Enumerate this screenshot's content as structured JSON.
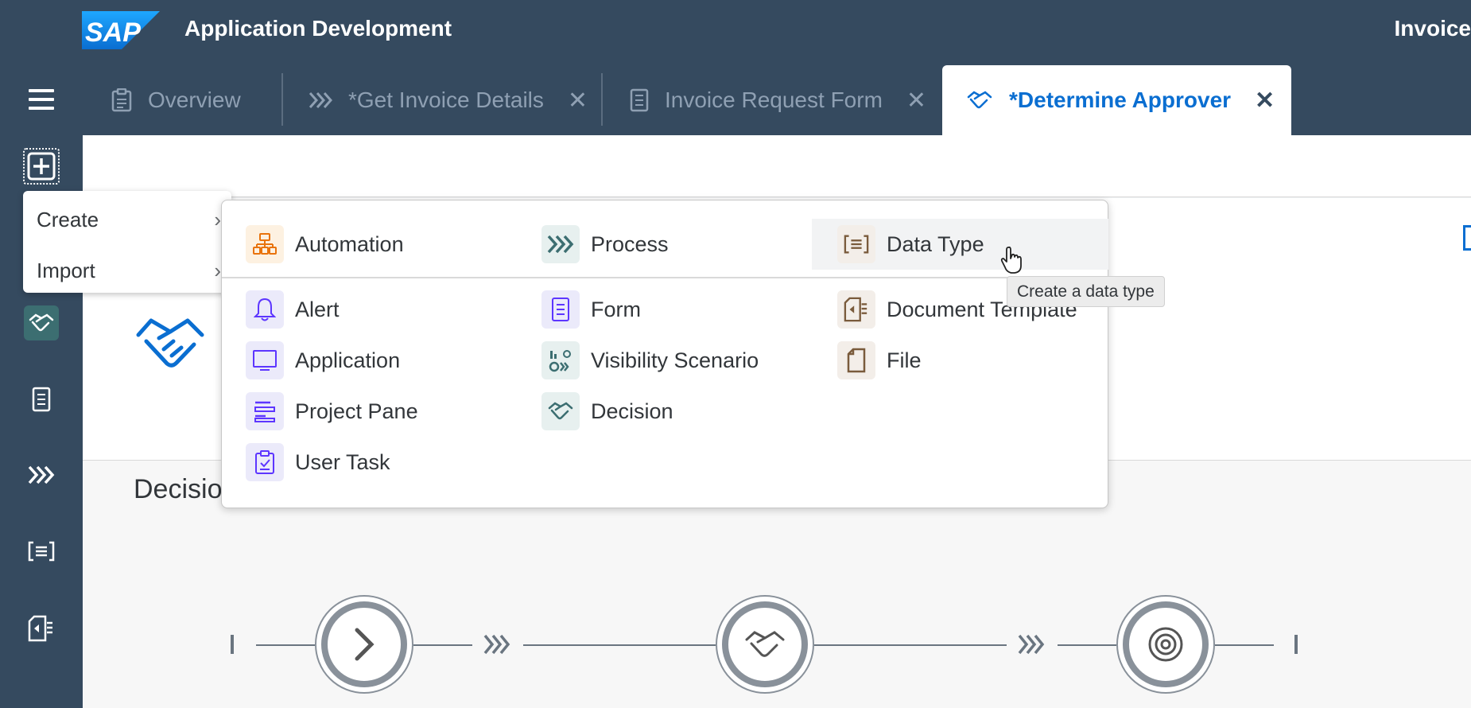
{
  "header": {
    "logo_text": "SAP",
    "app_title": "Application Development",
    "right_title": "Invoice"
  },
  "tabs": [
    {
      "label": "Overview",
      "icon": "clipboard-icon",
      "closable": false,
      "active": false
    },
    {
      "label": "*Get Invoice Details",
      "icon": "process-chevrons-icon",
      "closable": true,
      "active": false
    },
    {
      "label": "Invoice Request Form",
      "icon": "form-icon",
      "closable": true,
      "active": false
    },
    {
      "label": "*Determine Approver",
      "icon": "handshake-icon",
      "closable": true,
      "active": true
    }
  ],
  "tab_close_glyph": "✕",
  "sidebar": {
    "items": [
      "plus-icon",
      "handshake-icon",
      "form-icon",
      "process-chevrons-icon",
      "data-type-icon",
      "document-template-icon"
    ]
  },
  "create_menu": {
    "items": [
      {
        "label": "Create",
        "arrow": "›"
      },
      {
        "label": "Import",
        "arrow": "›"
      }
    ]
  },
  "submenu": {
    "header_items": [
      {
        "label": "Automation",
        "icon": "automation-icon"
      },
      {
        "label": "Process",
        "icon": "process-chevrons-icon"
      },
      {
        "label": "Data Type",
        "icon": "data-type-icon"
      }
    ],
    "col1": [
      {
        "label": "Alert",
        "icon": "bell-icon"
      },
      {
        "label": "Application",
        "icon": "monitor-icon"
      },
      {
        "label": "Project Pane",
        "icon": "project-pane-icon"
      },
      {
        "label": "User Task",
        "icon": "user-task-icon"
      }
    ],
    "col2": [
      {
        "label": "Form",
        "icon": "form-icon"
      },
      {
        "label": "Visibility Scenario",
        "icon": "visibility-scenario-icon"
      },
      {
        "label": "Decision",
        "icon": "handshake-icon"
      }
    ],
    "col3": [
      {
        "label": "Document Template",
        "icon": "document-template-icon"
      },
      {
        "label": "File",
        "icon": "file-icon"
      }
    ]
  },
  "tooltip": "Create a data type",
  "main": {
    "section_heading": "Decisio"
  },
  "colors": {
    "shell": "#354a5f",
    "accent": "#0a6ed1",
    "orange": "#e9730c",
    "teal": "#3c6e71",
    "purple": "#5d36ff",
    "brown": "#7a5b3c"
  }
}
